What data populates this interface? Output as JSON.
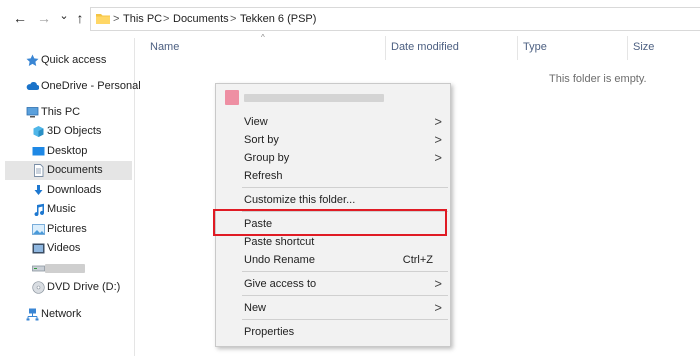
{
  "window": {
    "back_icon": "arrow-left-icon",
    "forward_icon": "arrow-right-icon",
    "recent_icon": "chevron-down-icon",
    "up_icon": "arrow-up-icon",
    "back_glyph": "←",
    "forward_glyph": "→",
    "recent_glyph": "⌄",
    "up_glyph": "↑"
  },
  "breadcrumb": {
    "items": [
      "This PC",
      "Documents",
      "Tekken 6 (PSP)"
    ],
    "separator": ">"
  },
  "sidebar": {
    "items": [
      {
        "label": "Quick access",
        "icon": "star-icon"
      },
      {
        "label": "OneDrive - Personal",
        "icon": "cloud-icon"
      },
      {
        "label": "This PC",
        "icon": "computer-icon"
      },
      {
        "label": "3D Objects",
        "icon": "cube-icon"
      },
      {
        "label": "Desktop",
        "icon": "desktop-icon"
      },
      {
        "label": "Documents",
        "icon": "document-icon",
        "selected": true
      },
      {
        "label": "Downloads",
        "icon": "download-icon"
      },
      {
        "label": "Music",
        "icon": "music-icon"
      },
      {
        "label": "Pictures",
        "icon": "picture-icon"
      },
      {
        "label": "Videos",
        "icon": "video-icon"
      },
      {
        "label": "",
        "icon": "drive-icon"
      },
      {
        "label": "DVD Drive (D:)",
        "icon": "dvd-icon"
      },
      {
        "label": "Network",
        "icon": "network-icon"
      }
    ]
  },
  "columns": {
    "name": "Name",
    "date_modified": "Date modified",
    "type": "Type",
    "size": "Size",
    "sort_glyph": "^"
  },
  "empty_message": "This folder is empty.",
  "context_menu": {
    "items": [
      {
        "label": "View",
        "submenu": true
      },
      {
        "label": "Sort by",
        "submenu": true
      },
      {
        "label": "Group by",
        "submenu": true
      },
      {
        "label": "Refresh"
      },
      {
        "label": "Customize this folder..."
      },
      {
        "label": "Paste"
      },
      {
        "label": "Paste shortcut"
      },
      {
        "label": "Undo Rename",
        "shortcut": "Ctrl+Z"
      },
      {
        "label": "Give access to",
        "submenu": true
      },
      {
        "label": "New",
        "submenu": true
      },
      {
        "label": "Properties"
      }
    ],
    "arrow_glyph": ">"
  },
  "colors": {
    "highlight": "#e01b24",
    "selected_bg": "#e5e5e5",
    "menu_bg": "#f2f2f2",
    "header_text": "#4d6082"
  }
}
